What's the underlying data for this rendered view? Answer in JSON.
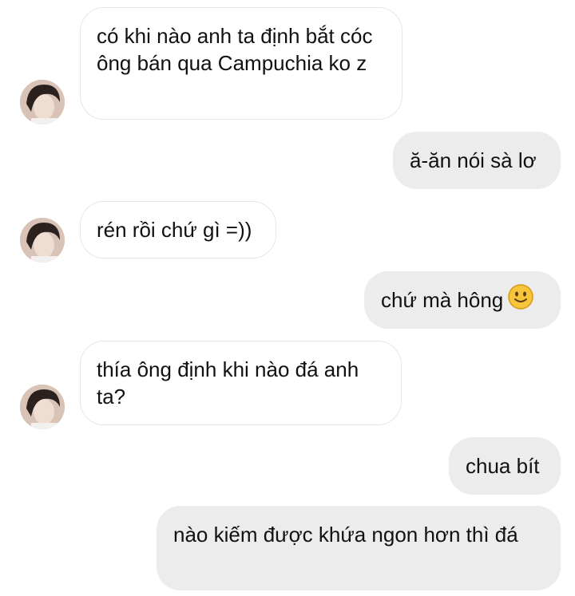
{
  "conversation": {
    "messages": [
      {
        "sender": "contact",
        "text": "có khi nào anh ta định bắt cóc ông bán qua Campuchia ko z"
      },
      {
        "sender": "me",
        "text": "ă-ăn nói sà lơ"
      },
      {
        "sender": "contact",
        "text": "rén rồi chứ gì =))"
      },
      {
        "sender": "me",
        "text": "chứ mà hông",
        "emoji": "slightly-smiling-face-icon"
      },
      {
        "sender": "contact",
        "text": "thía ông định khi nào đá anh ta?"
      },
      {
        "sender": "me",
        "text": "chua bít"
      },
      {
        "sender": "me",
        "text": "nào kiếm được khứa ngon hơn thì đá"
      }
    ]
  },
  "colors": {
    "incoming_bubble_bg": "#ffffff",
    "incoming_bubble_border": "#e6e6e6",
    "outgoing_bubble_bg": "#ececec",
    "text": "#111111",
    "emoji_yellow": "#f7c53a"
  }
}
